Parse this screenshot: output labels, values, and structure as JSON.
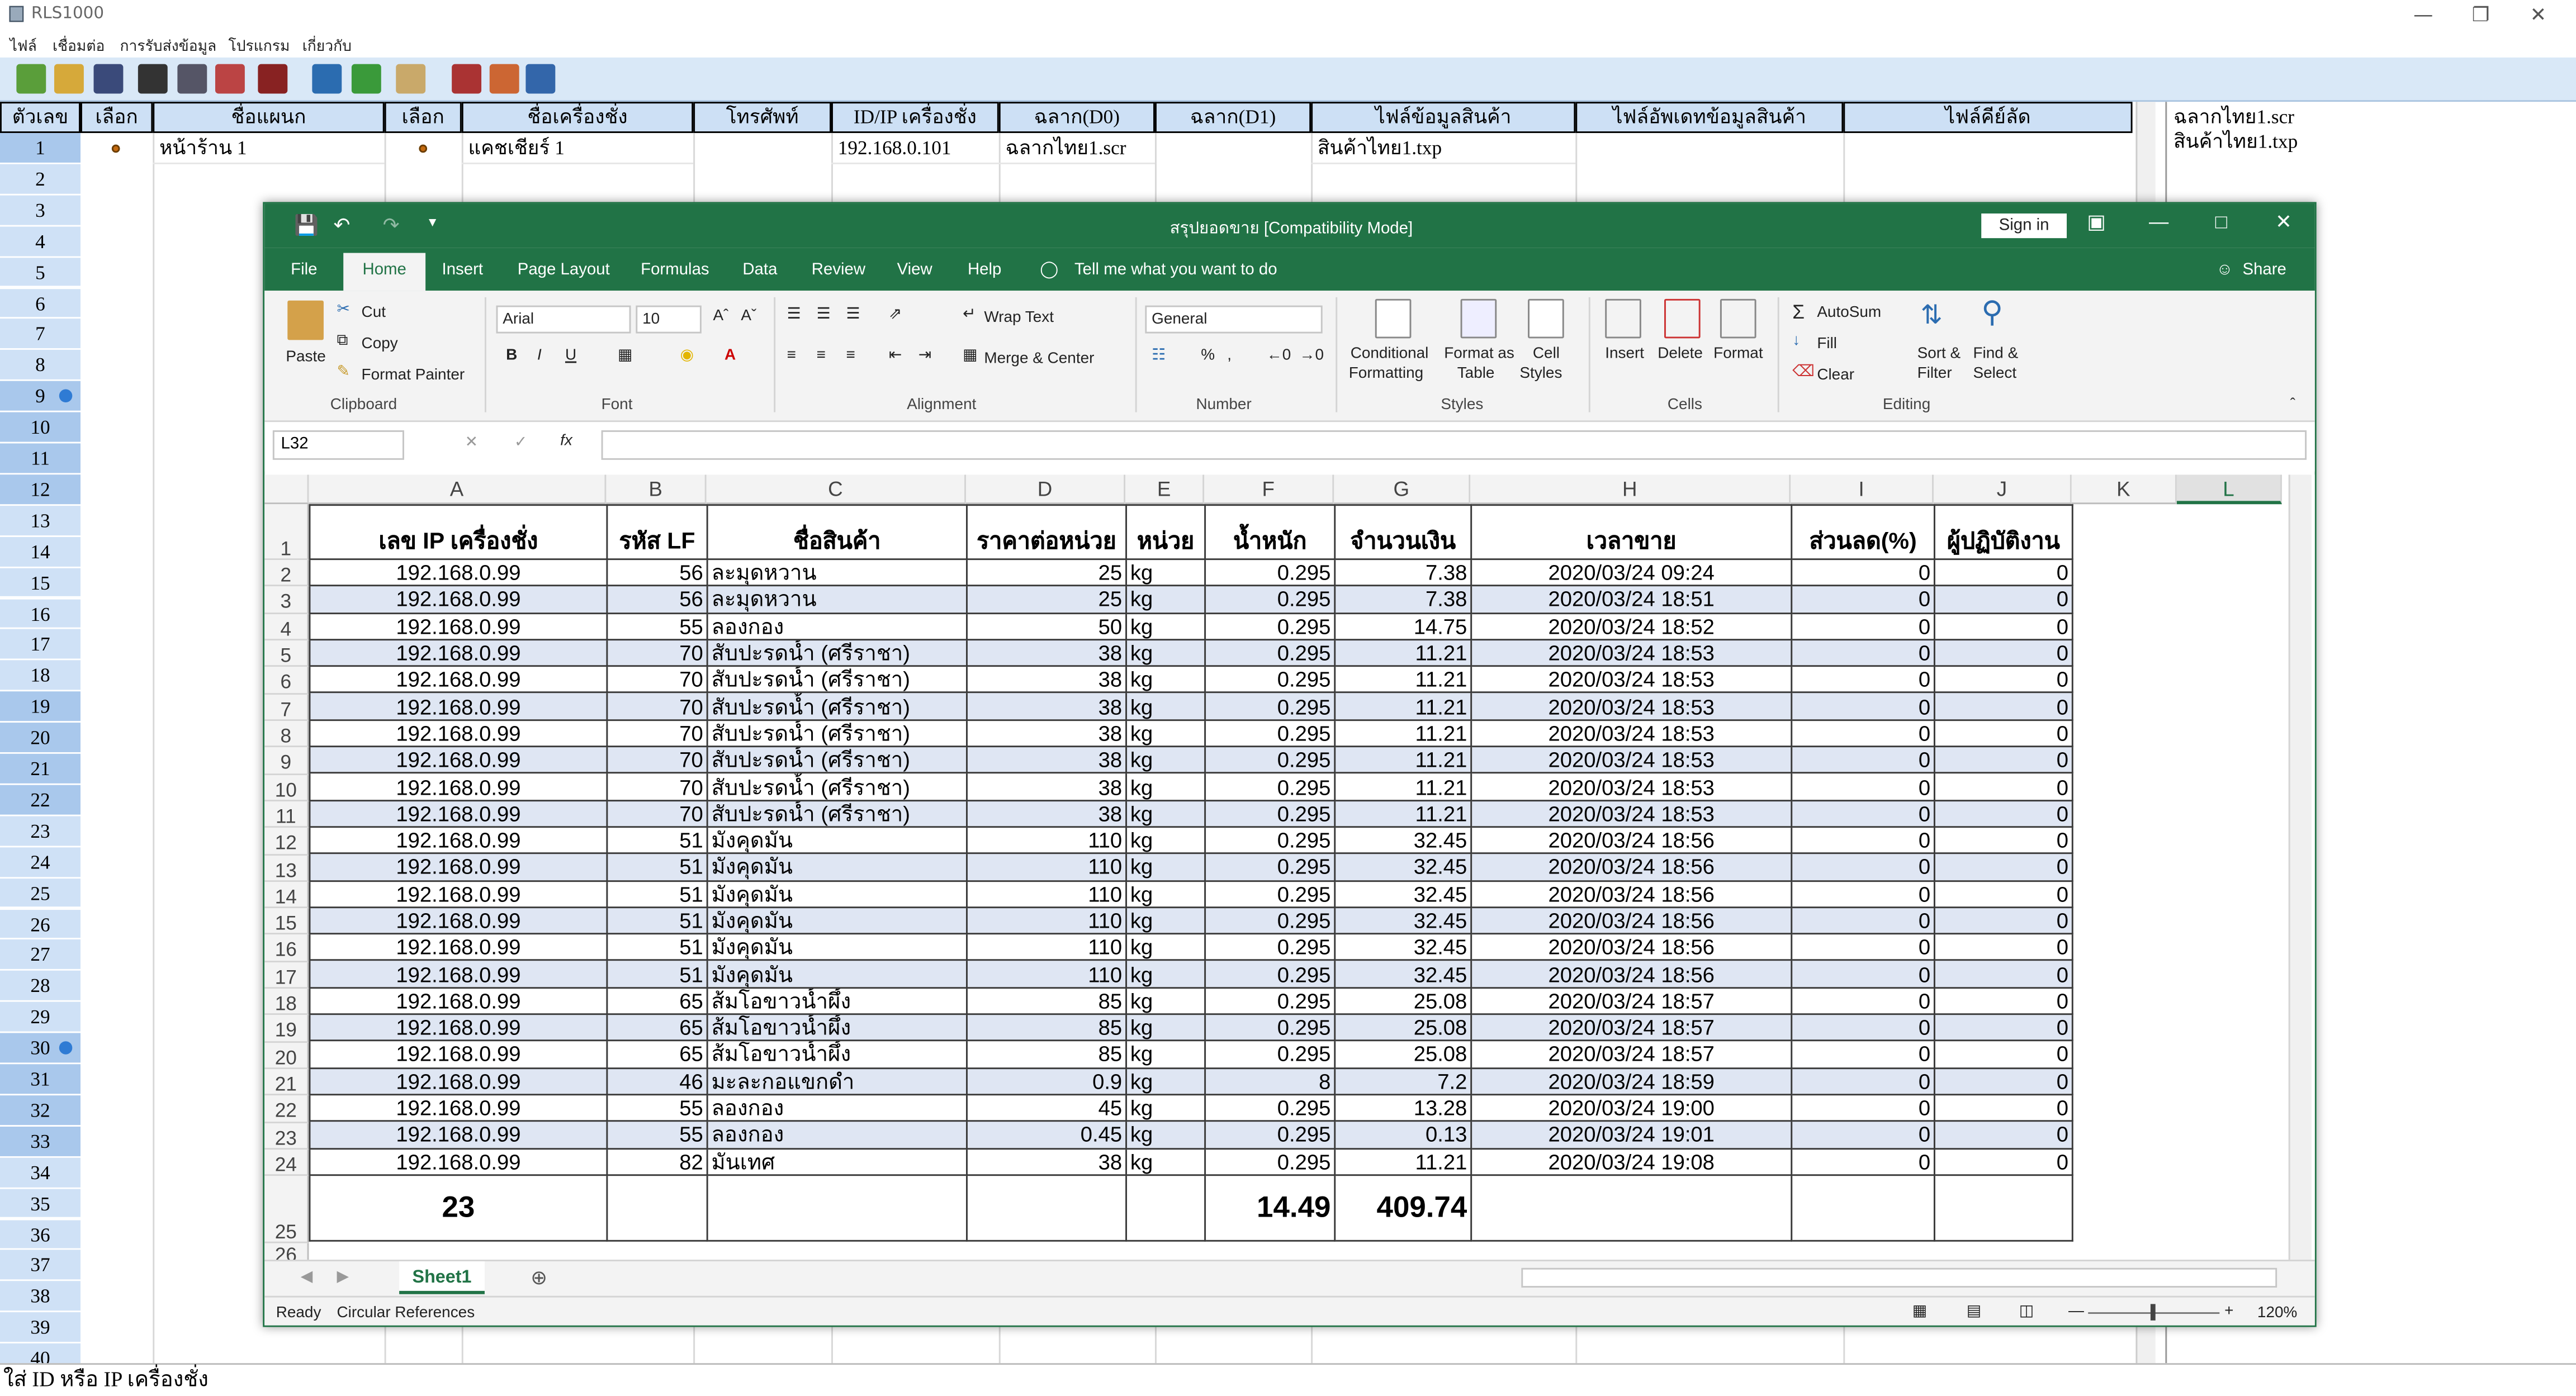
{
  "app": {
    "title": "RLS1000",
    "menu": [
      "ไฟล์",
      "เชื่อมต่อ",
      "การรับส่งข้อมูล",
      "โปรแกรม",
      "เกี่ยวกับ"
    ],
    "columns": [
      "ตัวเลข",
      "เลือก",
      "ชื่อแผนก",
      "เลือก",
      "ชื่อเครื่องชั่ง",
      "โทรศัพท์",
      "ID/IP เครื่องชั่ง",
      "ฉลาก(D0)",
      "ฉลาก(D1)",
      "ไฟล์ข้อมูลสินค้า",
      "ไฟล์อัพเดทข้อมูลสินค้า",
      "ไฟล์คีย์ลัด"
    ],
    "row1": {
      "num": "1",
      "dept": "หน้าร้าน 1",
      "scale": "แคชเชียร์ 1",
      "ip": "192.168.0.101",
      "label_d0": "ฉลากไทย1.scr",
      "product_file": "สินค้าไทย1.txp"
    },
    "row_numbers": [
      "1",
      "2",
      "3",
      "4",
      "5",
      "6",
      "7",
      "8",
      "9",
      "10",
      "11",
      "12",
      "13",
      "14",
      "15",
      "16",
      "17",
      "18",
      "19",
      "20",
      "21",
      "22",
      "23",
      "24",
      "25",
      "26",
      "27",
      "28",
      "29",
      "30",
      "31",
      "32",
      "33",
      "34",
      "35",
      "36",
      "37",
      "38",
      "39",
      "40"
    ],
    "right_list": [
      "ฉลากไทย1.scr",
      "สินค้าไทย1.txp"
    ],
    "status": "ใส่ ID หรือ IP เครื่องชั่ง"
  },
  "excel": {
    "title": "สรุปยอดขาย  [Compatibility Mode]",
    "signin": "Sign in",
    "tabs": [
      "File",
      "Home",
      "Insert",
      "Page Layout",
      "Formulas",
      "Data",
      "Review",
      "View",
      "Help",
      "Tell me what you want to do"
    ],
    "share": "Share",
    "ribbon": {
      "paste": "Paste",
      "cut": "Cut",
      "copy": "Copy",
      "format_painter": "Format Painter",
      "clipboard": "Clipboard",
      "font_name": "Arial",
      "font_size": "10",
      "font": "Font",
      "wrap_text": "Wrap Text",
      "merge_center": "Merge & Center",
      "alignment": "Alignment",
      "number_format": "General",
      "number": "Number",
      "cond_format_1": "Conditional",
      "cond_format_2": "Formatting",
      "format_table_1": "Format as",
      "format_table_2": "Table",
      "cell_styles_1": "Cell",
      "cell_styles_2": "Styles",
      "styles": "Styles",
      "insert": "Insert",
      "delete": "Delete",
      "format": "Format",
      "cells": "Cells",
      "autosum": "AutoSum",
      "fill": "Fill",
      "clear": "Clear",
      "sort_filter_1": "Sort &",
      "sort_filter_2": "Filter",
      "find_select_1": "Find &",
      "find_select_2": "Select",
      "editing": "Editing"
    },
    "name_box": "L32",
    "col_letters": [
      "A",
      "B",
      "C",
      "D",
      "E",
      "F",
      "G",
      "H",
      "I",
      "J",
      "K",
      "L"
    ],
    "headers": [
      "เลข IP เครื่องชั่ง",
      "รหัส LF",
      "ชื่อสินค้า",
      "ราคาต่อหน่วย",
      "หน่วย",
      "น้ำหนัก",
      "จำนวนเงิน",
      "เวลาขาย",
      "ส่วนลด(%)",
      "ผู้ปฏิบัติงาน"
    ],
    "rows": [
      [
        "192.168.0.99",
        "56",
        "ละมุดหวาน",
        "25",
        "kg",
        "0.295",
        "7.38",
        "2020/03/24 09:24",
        "0",
        "0"
      ],
      [
        "192.168.0.99",
        "56",
        "ละมุดหวาน",
        "25",
        "kg",
        "0.295",
        "7.38",
        "2020/03/24 18:51",
        "0",
        "0"
      ],
      [
        "192.168.0.99",
        "55",
        "ลองกอง",
        "50",
        "kg",
        "0.295",
        "14.75",
        "2020/03/24 18:52",
        "0",
        "0"
      ],
      [
        "192.168.0.99",
        "70",
        "สับปะรดน้ำ (ศรีราชา)",
        "38",
        "kg",
        "0.295",
        "11.21",
        "2020/03/24 18:53",
        "0",
        "0"
      ],
      [
        "192.168.0.99",
        "70",
        "สับปะรดน้ำ (ศรีราชา)",
        "38",
        "kg",
        "0.295",
        "11.21",
        "2020/03/24 18:53",
        "0",
        "0"
      ],
      [
        "192.168.0.99",
        "70",
        "สับปะรดน้ำ (ศรีราชา)",
        "38",
        "kg",
        "0.295",
        "11.21",
        "2020/03/24 18:53",
        "0",
        "0"
      ],
      [
        "192.168.0.99",
        "70",
        "สับปะรดน้ำ (ศรีราชา)",
        "38",
        "kg",
        "0.295",
        "11.21",
        "2020/03/24 18:53",
        "0",
        "0"
      ],
      [
        "192.168.0.99",
        "70",
        "สับปะรดน้ำ (ศรีราชา)",
        "38",
        "kg",
        "0.295",
        "11.21",
        "2020/03/24 18:53",
        "0",
        "0"
      ],
      [
        "192.168.0.99",
        "70",
        "สับปะรดน้ำ (ศรีราชา)",
        "38",
        "kg",
        "0.295",
        "11.21",
        "2020/03/24 18:53",
        "0",
        "0"
      ],
      [
        "192.168.0.99",
        "70",
        "สับปะรดน้ำ (ศรีราชา)",
        "38",
        "kg",
        "0.295",
        "11.21",
        "2020/03/24 18:53",
        "0",
        "0"
      ],
      [
        "192.168.0.99",
        "51",
        "มังคุดมัน",
        "110",
        "kg",
        "0.295",
        "32.45",
        "2020/03/24 18:56",
        "0",
        "0"
      ],
      [
        "192.168.0.99",
        "51",
        "มังคุดมัน",
        "110",
        "kg",
        "0.295",
        "32.45",
        "2020/03/24 18:56",
        "0",
        "0"
      ],
      [
        "192.168.0.99",
        "51",
        "มังคุดมัน",
        "110",
        "kg",
        "0.295",
        "32.45",
        "2020/03/24 18:56",
        "0",
        "0"
      ],
      [
        "192.168.0.99",
        "51",
        "มังคุดมัน",
        "110",
        "kg",
        "0.295",
        "32.45",
        "2020/03/24 18:56",
        "0",
        "0"
      ],
      [
        "192.168.0.99",
        "51",
        "มังคุดมัน",
        "110",
        "kg",
        "0.295",
        "32.45",
        "2020/03/24 18:56",
        "0",
        "0"
      ],
      [
        "192.168.0.99",
        "51",
        "มังคุดมัน",
        "110",
        "kg",
        "0.295",
        "32.45",
        "2020/03/24 18:56",
        "0",
        "0"
      ],
      [
        "192.168.0.99",
        "65",
        "ส้มโอขาวน้ำผึ้ง",
        "85",
        "kg",
        "0.295",
        "25.08",
        "2020/03/24 18:57",
        "0",
        "0"
      ],
      [
        "192.168.0.99",
        "65",
        "ส้มโอขาวน้ำผึ้ง",
        "85",
        "kg",
        "0.295",
        "25.08",
        "2020/03/24 18:57",
        "0",
        "0"
      ],
      [
        "192.168.0.99",
        "65",
        "ส้มโอขาวน้ำผึ้ง",
        "85",
        "kg",
        "0.295",
        "25.08",
        "2020/03/24 18:57",
        "0",
        "0"
      ],
      [
        "192.168.0.99",
        "46",
        "มะละกอแขกดำ",
        "0.9",
        "kg",
        "8",
        "7.2",
        "2020/03/24 18:59",
        "0",
        "0"
      ],
      [
        "192.168.0.99",
        "55",
        "ลองกอง",
        "45",
        "kg",
        "0.295",
        "13.28",
        "2020/03/24 19:00",
        "0",
        "0"
      ],
      [
        "192.168.0.99",
        "55",
        "ลองกอง",
        "0.45",
        "kg",
        "0.295",
        "0.13",
        "2020/03/24 19:01",
        "0",
        "0"
      ],
      [
        "192.168.0.99",
        "82",
        "มันเทศ",
        "38",
        "kg",
        "0.295",
        "11.21",
        "2020/03/24 19:08",
        "0",
        "0"
      ]
    ],
    "totals": {
      "count": "23",
      "weight": "14.49",
      "amount": "409.74"
    },
    "sheet_tab": "Sheet1",
    "status_ready": "Ready",
    "status_circular": "Circular References",
    "zoom": "120%"
  }
}
